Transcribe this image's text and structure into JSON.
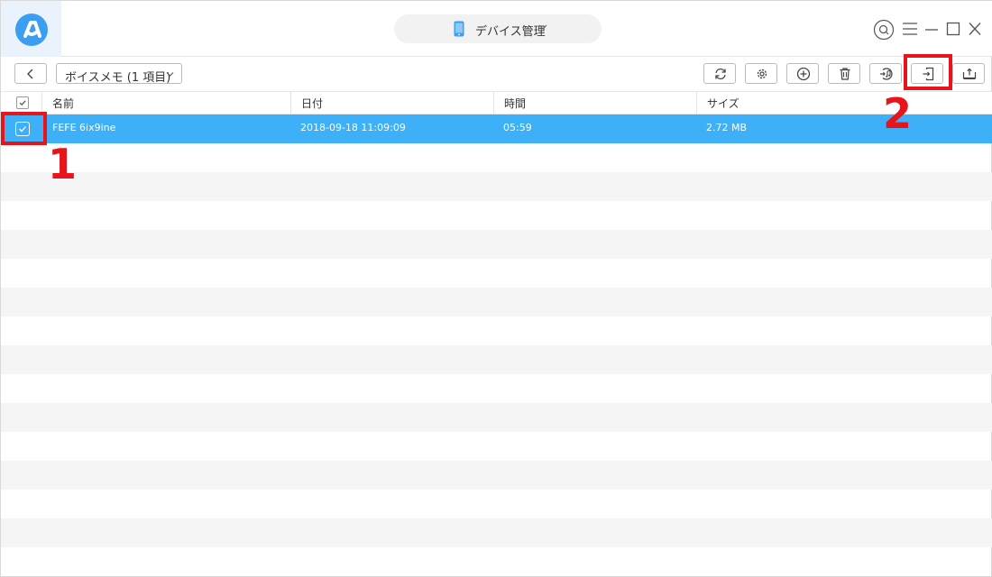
{
  "titlebar": {
    "device_label": "デバイス管理",
    "icons": [
      "app-logo-icon",
      "phone-icon",
      "chevron-down-icon",
      "search-icon",
      "menu-icon",
      "minimize-icon",
      "maximize-icon",
      "close-icon"
    ]
  },
  "toolbar": {
    "category_label": "ボイスメモ (1 項目)",
    "buttons": [
      "refresh-icon",
      "settings-icon",
      "add-icon",
      "delete-icon",
      "to-itunes-icon",
      "to-computer-icon",
      "to-device-icon"
    ]
  },
  "table": {
    "columns": [
      "名前",
      "日付",
      "時間",
      "サイズ"
    ],
    "rows": [
      {
        "name": "FEFE 6ix9ine",
        "date": "2018-09-18 11:09:09",
        "time": "05:59",
        "size": "2.72 MB",
        "checked": true,
        "selected": true
      }
    ]
  },
  "annotations": {
    "step1": "1",
    "step2": "2",
    "color": "#e8141b"
  },
  "colors": {
    "accent": "#3db0f7",
    "logo": "#3c9ef0",
    "highlight": "#e8141b"
  }
}
